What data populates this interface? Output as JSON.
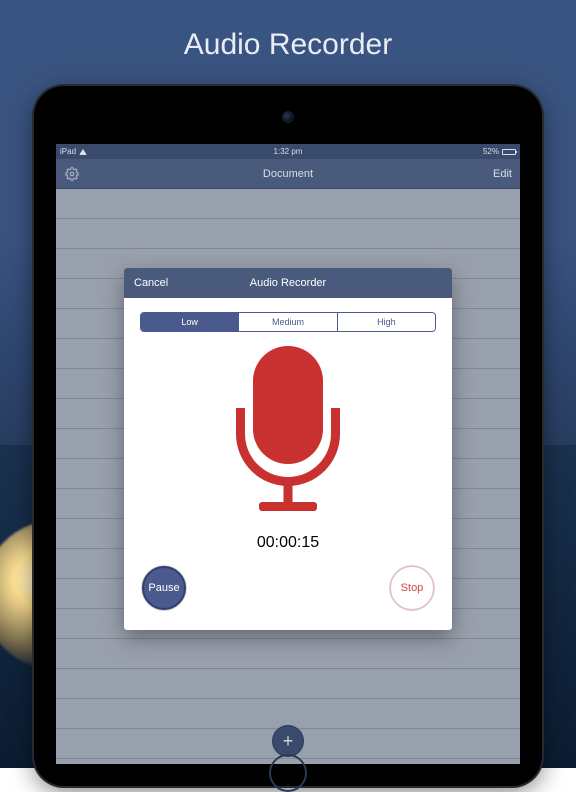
{
  "page_title": "Audio Recorder",
  "statusbar": {
    "device": "iPad",
    "time": "1:32 pm",
    "battery_pct": "52%"
  },
  "navbar": {
    "title": "Document",
    "edit_label": "Edit"
  },
  "add_button": {
    "label": "+"
  },
  "modal": {
    "cancel_label": "Cancel",
    "title": "Audio Recorder",
    "quality": {
      "options": [
        "Low",
        "Medium",
        "High"
      ],
      "selected_index": 0
    },
    "timer": "00:00:15",
    "pause_label": "Pause",
    "stop_label": "Stop"
  },
  "colors": {
    "navbar": "#4a5a7d",
    "accent": "#4a5a8d",
    "mic": "#c93030",
    "stop": "#d64545"
  }
}
